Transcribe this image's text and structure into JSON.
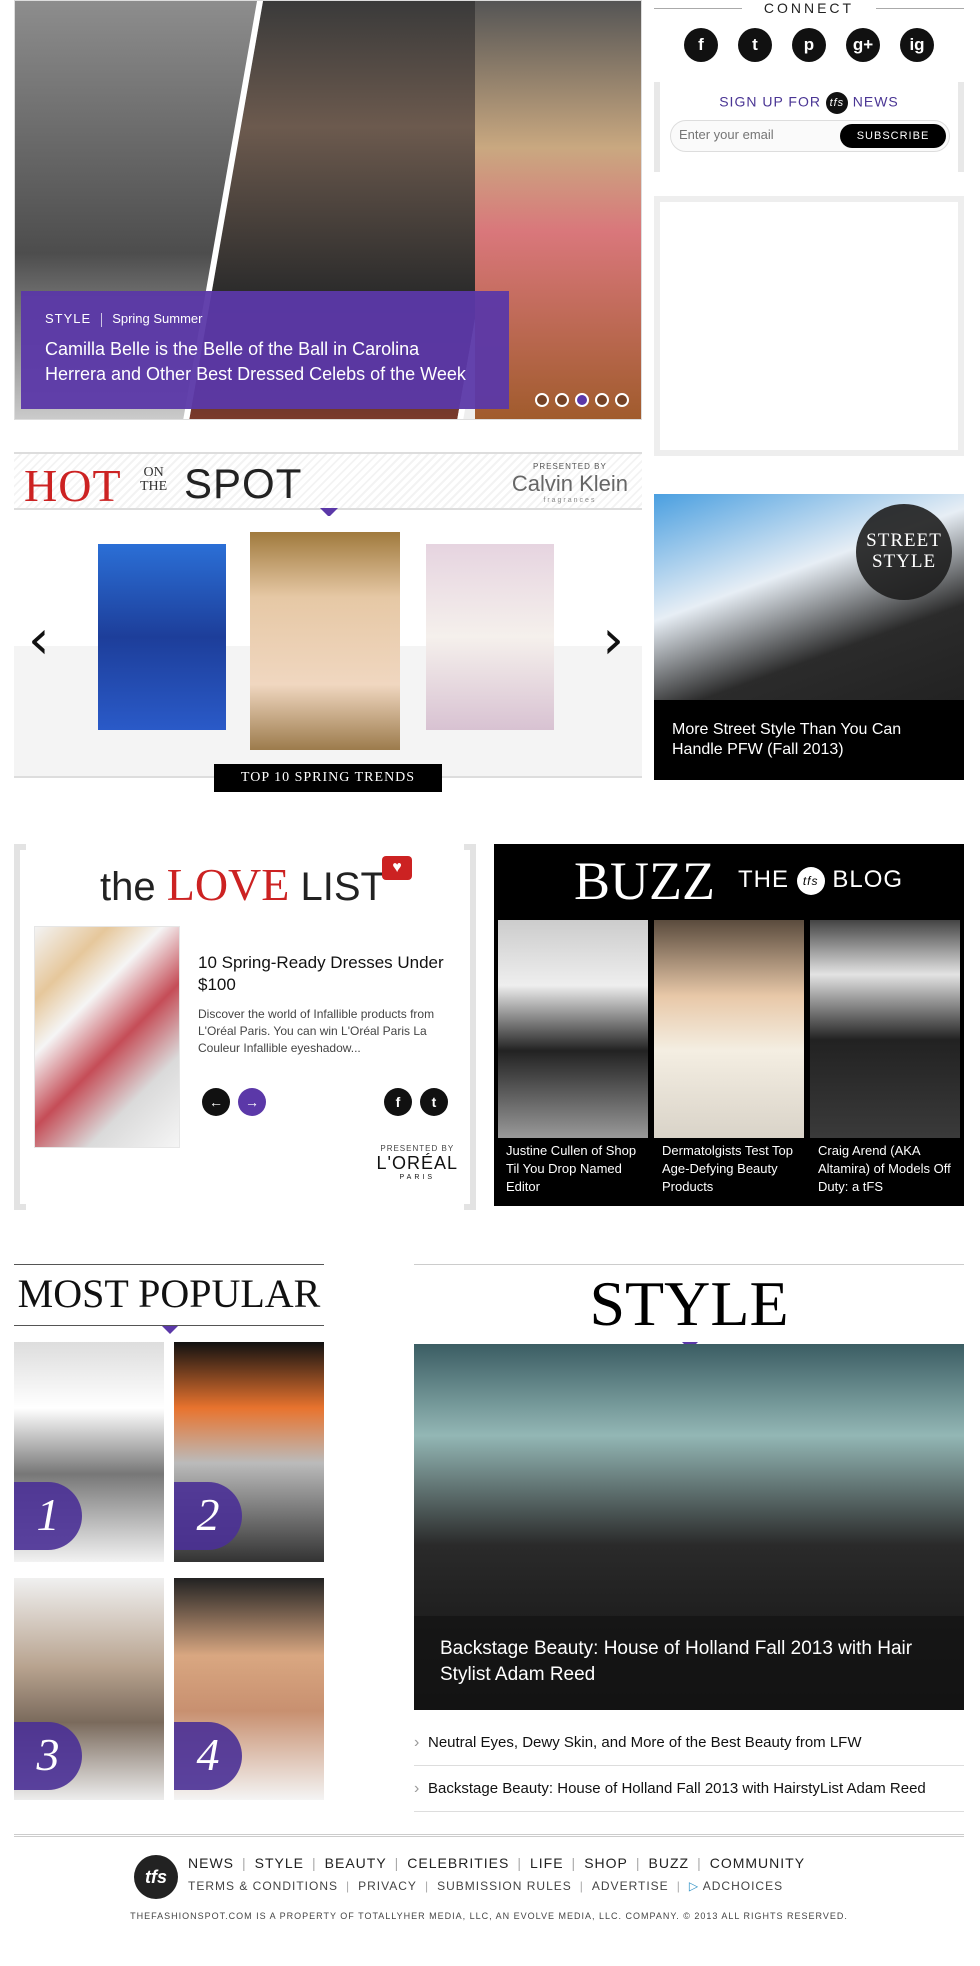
{
  "hero": {
    "category": "STYLE",
    "subcategory": "Spring Summer",
    "title": "Camilla Belle is the Belle of the Ball in Carolina Herrera and Other Best Dressed Celebs of the Week",
    "slides_total": 5,
    "active_slide": 3
  },
  "connect": {
    "heading": "CONNECT",
    "social": [
      "f",
      "t",
      "p",
      "g+",
      "ig"
    ]
  },
  "signup": {
    "title_prefix": "SIGN UP FOR",
    "logo": "tfs",
    "title_suffix": "NEWS",
    "email_placeholder": "Enter your email",
    "subscribe_label": "SUBSCRIBE"
  },
  "hot_on_the_spot": {
    "title_hot": "HOT",
    "title_onthe_1": "ON",
    "title_onthe_2": "THE",
    "title_spot": "SPOT",
    "presented_by": "PRESENTED BY",
    "sponsor": "Calvin Klein",
    "sponsor_sub": "fragrances",
    "prev": "‹",
    "next": "›",
    "cta": "TOP 10 SPRING TRENDS"
  },
  "street_style": {
    "badge_line1": "STREET",
    "badge_line2": "STYLE",
    "title": "More Street Style Than You Can Handle PFW (Fall 2013)"
  },
  "love_list": {
    "title_the": "the",
    "title_love": "LOVE",
    "title_list": "LIST",
    "heading": "10 Spring-Ready Dresses Under $100",
    "description": "Discover the world of Infallible products from L'Oréal Paris. You can win L'Oréal Paris La Couleur Infallible eyeshadow...",
    "prev": "←",
    "next": "→",
    "presented_by": "PRESENTED BY",
    "sponsor": "L'ORÉAL",
    "sponsor_sub": "PARIS"
  },
  "buzz": {
    "title": "BUZZ",
    "sub_the": "THE",
    "sub_logo": "tfs",
    "sub_blog": "BLOG",
    "items": [
      {
        "caption": "Justine Cullen of Shop Til You Drop Named Editor"
      },
      {
        "caption": "Dermatolgists Test Top Age-Defying Beauty Products"
      },
      {
        "caption": "Craig Arend (AKA Altamira) of Models Off Duty: a tFS"
      }
    ]
  },
  "most_popular": {
    "title": "MOST POPULAR",
    "items": [
      "1",
      "2",
      "3",
      "4"
    ]
  },
  "style": {
    "title": "STYLE",
    "feature_title": "Backstage Beauty: House of Holland Fall 2013 with Hair Stylist Adam Reed",
    "links": [
      "Neutral Eyes, Dewy Skin, and More of the Best Beauty from LFW",
      "Backstage Beauty: House of Holland Fall 2013 with HairstyList Adam Reed"
    ]
  },
  "footer": {
    "logo": "tfs",
    "nav": [
      "NEWS",
      "STYLE",
      "BEAUTY",
      "CELEBRITIES",
      "LIFE",
      "SHOP",
      "BUZZ",
      "COMMUNITY"
    ],
    "links": [
      "TERMS & CONDITIONS",
      "PRIVACY",
      "SUBMISSION RULES",
      "ADVERTISE",
      "ADCHOICES"
    ],
    "copyright": "THEFASHIONSPOT.COM IS A PROPERTY OF TOTALLYHER MEDIA, LLC, AN EVOLVE MEDIA, LLC. COMPANY. © 2013 ALL RIGHTS RESERVED."
  }
}
